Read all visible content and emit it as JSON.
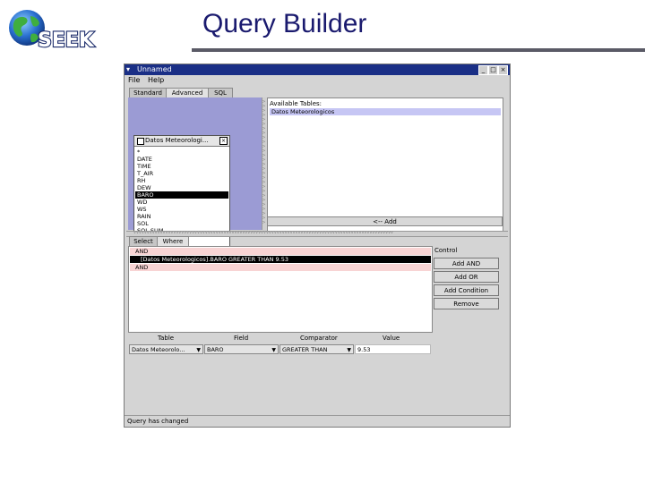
{
  "slide": {
    "title": "Query Builder",
    "logo_text": "SEEK"
  },
  "window": {
    "title": "Unnamed",
    "menus": [
      "File",
      "Help"
    ],
    "top_tabs": [
      "Standard",
      "Advanced",
      "SQL"
    ],
    "field_box": {
      "title": "Datos Meteorologi...",
      "fields": [
        "*",
        "DATE",
        "TIME",
        "T_AIR",
        "RH",
        "DEW",
        "BARO",
        "WD",
        "WS",
        "RAIN",
        "SOL",
        "SOL SUM"
      ],
      "selected_index": 6
    },
    "tables": {
      "header": "Available Tables:",
      "items": [
        "Datos Meteorologicos"
      ],
      "add_label": "<-- Add"
    },
    "bottom_tabs": [
      "Select",
      "Where"
    ],
    "conditions": [
      "AND",
      "[Datos Meteorologicos].BARO GREATER THAN 9.53",
      "AND"
    ],
    "control": {
      "label": "Control",
      "buttons": [
        "Add AND",
        "Add OR",
        "Add Condition",
        "Remove"
      ]
    },
    "columns": [
      "Table",
      "Field",
      "Comparator",
      "Value"
    ],
    "row": {
      "table": "Datos Meteorolo...",
      "field": "BARO",
      "comparator": "GREATER THAN",
      "value": "9.53"
    },
    "status": "Query has changed"
  },
  "colors": {
    "titlebar": "#1a2f86",
    "left_panel": "#9b9bd4",
    "selection": "#000000",
    "pink_row": "#f8d4d4",
    "table_highlight": "#c6c6f4"
  }
}
